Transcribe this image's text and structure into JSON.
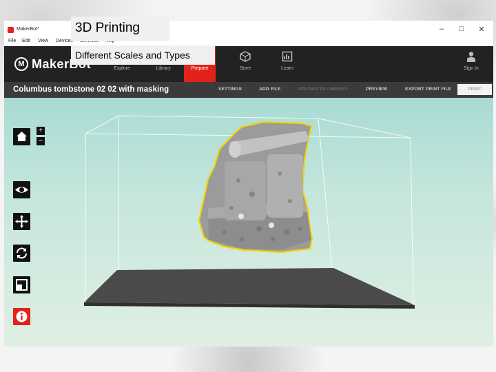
{
  "slide": {
    "title": "3D Printing",
    "subtitle": "Different Scales and Types"
  },
  "window": {
    "app_title": "MakerBot*",
    "controls": {
      "minimize": "–",
      "maximize": "□",
      "close": "✕"
    }
  },
  "menu": {
    "items": [
      "File",
      "Edit",
      "View",
      "Devices",
      "Services",
      "Help"
    ]
  },
  "nav": {
    "brand": "MakerBot",
    "items": [
      {
        "label": "Explore",
        "icon": "explore-icon"
      },
      {
        "label": "Library",
        "icon": "library-icon"
      },
      {
        "label": "Prepare",
        "icon": "prepare-icon",
        "active": true
      },
      {
        "label": "Store",
        "icon": "store-icon"
      },
      {
        "label": "Learn",
        "icon": "learn-icon"
      }
    ],
    "sign_in": "Sign In",
    "accent": "#e2231a"
  },
  "toolbar": {
    "file_name": "Columbus tombstone 02 02 with masking",
    "settings": "SETTINGS",
    "add_file": "ADD FILE",
    "upload": "UPLOAD TO LIBRARY",
    "preview": "PREVIEW",
    "export": "EXPORT PRINT FILE",
    "print": "PRINT"
  },
  "viewport": {
    "zoom_in": "+",
    "zoom_out": "−",
    "tools": [
      "home-view-icon",
      "view-icon",
      "move-icon",
      "rotate-icon",
      "scale-icon",
      "info-icon"
    ]
  }
}
